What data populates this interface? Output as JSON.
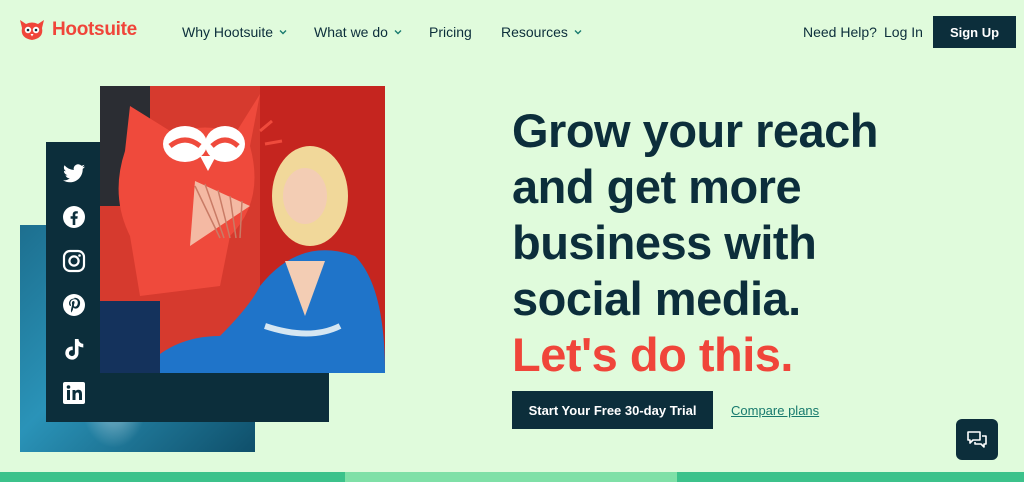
{
  "header": {
    "logo_text": "Hootsuite",
    "nav_items": [
      {
        "label": "Why Hootsuite",
        "has_dropdown": true
      },
      {
        "label": "What we do",
        "has_dropdown": true
      },
      {
        "label": "Pricing",
        "has_dropdown": false
      },
      {
        "label": "Resources",
        "has_dropdown": true
      }
    ],
    "help_label": "Need Help?",
    "login_label": "Log In",
    "signup_label": "Sign Up"
  },
  "hero": {
    "headline_lines": [
      "Grow your reach",
      "and get more",
      "business with",
      "social media."
    ],
    "accent_line": "Let's do this.",
    "cta_label": "Start Your Free 30-day Trial",
    "compare_label": "Compare plans",
    "social_icons": [
      "twitter-icon",
      "facebook-icon",
      "instagram-icon",
      "pinterest-icon",
      "tiktok-icon",
      "linkedin-icon"
    ]
  },
  "colors": {
    "background": "#e0fbdc",
    "brand_red": "#f0453a",
    "navy": "#0c2e3b",
    "link_teal": "#187a6e"
  }
}
